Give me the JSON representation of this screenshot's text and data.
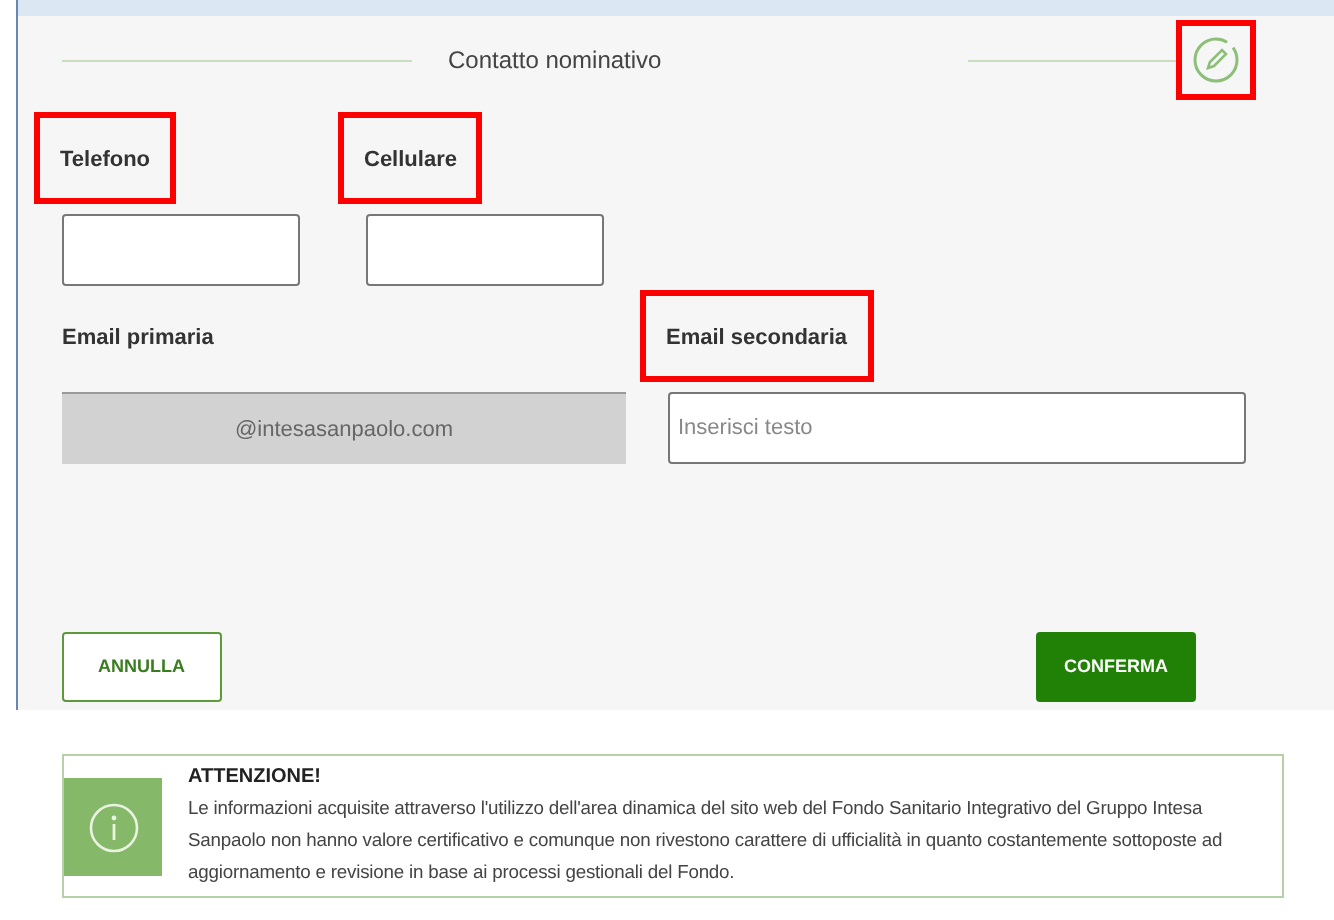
{
  "section": {
    "title": "Contatto nominativo",
    "edit_highlighted": true
  },
  "fields": [
    {
      "label": "Telefono",
      "highlighted": true,
      "disabled": false
    },
    {
      "label": "Cellulare",
      "highlighted": true,
      "disabled": false
    }
  ],
  "email_fields": [
    {
      "label": "Email primaria",
      "highlighted": false,
      "value": "@intesasanpaolo.com",
      "disabled": true
    },
    {
      "label": "Email secondaria",
      "highlighted": true,
      "placeholder": "Inserisci testo",
      "disabled": false
    }
  ],
  "buttons": [
    {
      "label": "ANNULLA",
      "kind": "outline"
    },
    {
      "label": "CONFERMA",
      "kind": "primary"
    }
  ],
  "notice": {
    "title": "ATTENZIONE!",
    "text": "Le informazioni acquisite attraverso l'utilizzo dell'area dinamica del sito web del Fondo Sanitario Integrativo del Gruppo Intesa Sanpaolo non hanno valore certificativo e comunque non rivestono carattere di ufficialità in quanto costantemente sottoposte ad aggiornamento e revisione in base ai processi gestionali del Fondo."
  }
}
